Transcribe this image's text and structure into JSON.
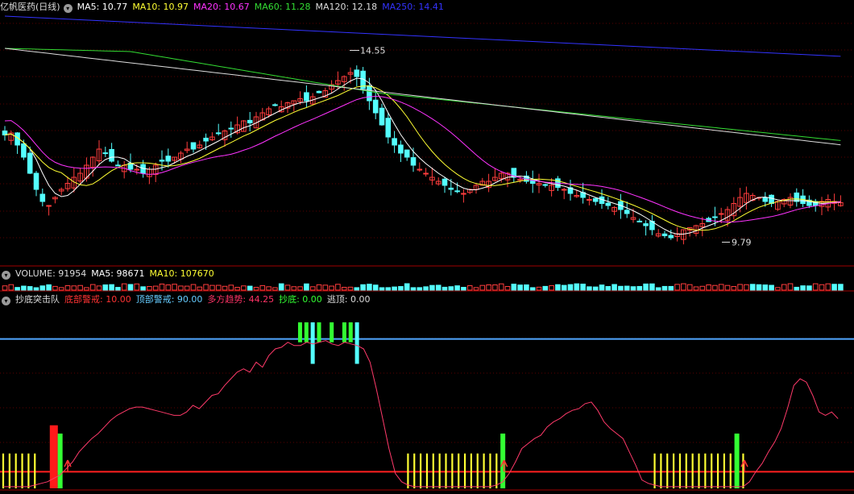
{
  "price_panel": {
    "title": "亿帆医药(日线)",
    "ma_items": [
      {
        "label": "MA5: 10.77",
        "color": "#ffffff"
      },
      {
        "label": "MA10: 10.97",
        "color": "#ffff33"
      },
      {
        "label": "MA20: 10.67",
        "color": "#ff33ff"
      },
      {
        "label": "MA60: 11.28",
        "color": "#33dd33"
      },
      {
        "label": "MA120: 12.18",
        "color": "#dddddd"
      },
      {
        "label": "MA250: 14.41",
        "color": "#3333ff"
      }
    ],
    "high_label": "14.55",
    "low_label": "9.79"
  },
  "volume_panel": {
    "items": [
      {
        "label": "VOLUME: 91954",
        "color": "#dddddd"
      },
      {
        "label": "MA5: 98671",
        "color": "#ffffff"
      },
      {
        "label": "MA10: 107670",
        "color": "#ffff33"
      }
    ]
  },
  "indicator_panel": {
    "items": [
      {
        "label": "抄底突击队",
        "color": "#dddddd"
      },
      {
        "label": "底部警戒: 10.00",
        "color": "#ff3333"
      },
      {
        "label": "顶部警戒: 90.00",
        "color": "#66ccff"
      },
      {
        "label": "多方趋势: 44.25",
        "color": "#ff3366"
      },
      {
        "label": "抄底: 0.00",
        "color": "#33ff33"
      },
      {
        "label": "逃顶: 0.00",
        "color": "#dddddd"
      }
    ]
  },
  "chart_data": [
    {
      "type": "candlestick",
      "title": "亿帆医药(日线)",
      "marked_high": 14.55,
      "marked_low": 9.79,
      "last_ma": {
        "MA5": 10.77,
        "MA10": 10.97,
        "MA20": 10.67,
        "MA60": 11.28,
        "MA120": 12.18,
        "MA250": 14.41
      }
    },
    {
      "type": "bar",
      "title": "VOLUME",
      "last": {
        "VOLUME": 91954,
        "MA5": 98671,
        "MA10": 107670
      }
    },
    {
      "type": "line",
      "title": "抄底突击队",
      "ylim": [
        0,
        100
      ],
      "reference_lines": [
        {
          "name": "底部警戒",
          "value": 10.0,
          "color": "#ff2020"
        },
        {
          "name": "顶部警戒",
          "value": 90.0,
          "color": "#4fa6ff"
        }
      ],
      "series": [
        {
          "name": "多方趋势",
          "color": "#ff3a6a",
          "values": [
            1,
            1,
            1,
            1,
            1,
            2,
            3,
            4,
            6,
            8,
            12,
            16,
            22,
            26,
            30,
            33,
            37,
            41,
            44,
            46,
            48,
            49,
            49,
            48,
            47,
            46,
            45,
            44,
            44,
            46,
            50,
            48,
            52,
            56,
            57,
            62,
            66,
            70,
            72,
            70,
            76,
            73,
            80,
            84,
            85,
            88,
            86,
            86,
            88,
            87,
            88,
            89,
            87,
            86,
            88,
            87,
            86,
            84,
            76,
            60,
            42,
            24,
            9,
            4,
            2,
            1,
            1,
            1,
            1,
            1,
            1,
            1,
            1,
            1,
            1,
            1,
            1,
            1,
            2,
            4,
            9,
            16,
            24,
            27,
            30,
            32,
            37,
            40,
            42,
            45,
            47,
            48,
            51,
            52,
            47,
            40,
            36,
            33,
            30,
            22,
            14,
            5,
            3,
            2,
            1,
            1,
            1,
            1,
            1,
            1,
            1,
            1,
            1,
            1,
            1,
            1,
            1,
            1,
            4,
            10,
            15,
            22,
            28,
            36,
            48,
            62,
            66,
            64,
            56,
            46,
            44,
            46,
            42
          ]
        },
        {
          "name": "抄底",
          "color": "#33ff33",
          "values": [
            0,
            0,
            0,
            0,
            0,
            0,
            0,
            0,
            0,
            0,
            0,
            0,
            0,
            0,
            0,
            0,
            0,
            0,
            0,
            0,
            0,
            0,
            0,
            0,
            0,
            0,
            0,
            0,
            0,
            0,
            0,
            0,
            0,
            0,
            0,
            0,
            0,
            0,
            0,
            0,
            0,
            0,
            0,
            0,
            0,
            0,
            0,
            0,
            0,
            0,
            0,
            0,
            0,
            0,
            0,
            0,
            0,
            0,
            0,
            0,
            0,
            0,
            0,
            0,
            0,
            0,
            0,
            0,
            0,
            0,
            0,
            0,
            0,
            0,
            0,
            0,
            0,
            0,
            0,
            0,
            0,
            0,
            0,
            0,
            0,
            0,
            0,
            0,
            0,
            0,
            0,
            0,
            0,
            0,
            0,
            0,
            0,
            0,
            0,
            0,
            0,
            0,
            0,
            0,
            0,
            0,
            0,
            0,
            0,
            0,
            0,
            0,
            0,
            0,
            0,
            0,
            0,
            0,
            0,
            0,
            0,
            0,
            0,
            0,
            0,
            0,
            0,
            0,
            0,
            0,
            0,
            0,
            0,
            0
          ]
        },
        {
          "name": "逃顶",
          "color": "#dddddd",
          "values": [
            0,
            0,
            0,
            0,
            0,
            0,
            0,
            0,
            0,
            0,
            0,
            0,
            0,
            0,
            0,
            0,
            0,
            0,
            0,
            0,
            0,
            0,
            0,
            0,
            0,
            0,
            0,
            0,
            0,
            0,
            0,
            0,
            0,
            0,
            0,
            0,
            0,
            0,
            0,
            0,
            0,
            0,
            0,
            0,
            0,
            0,
            0,
            0,
            0,
            0,
            0,
            0,
            0,
            0,
            0,
            0,
            0,
            0,
            0,
            0,
            0,
            0,
            0,
            0,
            0,
            0,
            0,
            0,
            0,
            0,
            0,
            0,
            0,
            0,
            0,
            0,
            0,
            0,
            0,
            0,
            0,
            0,
            0,
            0,
            0,
            0,
            0,
            0,
            0,
            0,
            0,
            0,
            0,
            0,
            0,
            0,
            0,
            0,
            0,
            0,
            0,
            0,
            0,
            0,
            0,
            0,
            0,
            0,
            0,
            0,
            0,
            0,
            0,
            0,
            0,
            0,
            0,
            0,
            0,
            0,
            0,
            0,
            0,
            0,
            0,
            0,
            0,
            0,
            0,
            0,
            0,
            0,
            0,
            0
          ]
        }
      ]
    }
  ]
}
